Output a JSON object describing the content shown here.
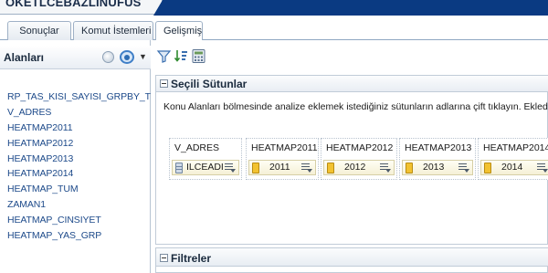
{
  "window": {
    "title": "OKETLCEBAZLINUFUS"
  },
  "tabs": [
    {
      "label": "Sonuçlar"
    },
    {
      "label": "Komut İstemleri"
    },
    {
      "label": "Gelişmiş"
    }
  ],
  "left_panel": {
    "title": "Alanları",
    "items": [
      "RP_TAS_KISI_SAYISI_GRPBY_TR",
      "V_ADRES",
      "HEATMAP2011",
      "HEATMAP2012",
      "HEATMAP2013",
      "HEATMAP2014",
      "HEATMAP_TUM",
      "ZAMAN1",
      "HEATMAP_CINSIYET",
      "HEATMAP_YAS_GRP"
    ]
  },
  "selected_columns": {
    "title": "Seçili Sütunlar",
    "description": "Konu Alanları bölmesinde analize eklemek istediğiniz sütunların adlarına çift tıklayın. Ekledikte",
    "columns": [
      {
        "header": "V_ADRES",
        "value": "ILCEADI",
        "icon": "table-icon"
      },
      {
        "header": "HEATMAP2011",
        "value": "2011",
        "icon": "measure-icon"
      },
      {
        "header": "HEATMAP2012",
        "value": "2012",
        "icon": "measure-icon"
      },
      {
        "header": "HEATMAP2013",
        "value": "2013",
        "icon": "measure-icon"
      },
      {
        "header": "HEATMAP2014",
        "value": "2014",
        "icon": "measure-icon"
      }
    ]
  },
  "filters": {
    "title": "Filtreler"
  },
  "colors": {
    "title_band": "#0a3a82",
    "link_text": "#1d4a8a",
    "measure_icon": "#f2c230"
  }
}
